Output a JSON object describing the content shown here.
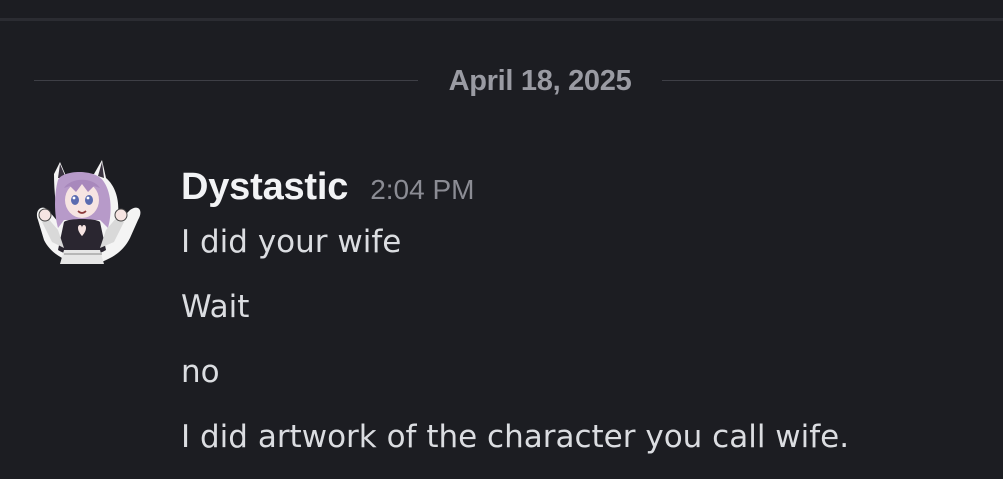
{
  "date_divider": {
    "label": "April 18, 2025"
  },
  "message": {
    "username": "Dystastic",
    "timestamp": "2:04 PM",
    "avatar": {
      "icon": "anime-girl-avatar",
      "hair_color": "#b79ac9",
      "accent_color": "#e8e8e8"
    },
    "lines": [
      "I did your wife",
      "Wait",
      "no",
      "I did artwork of the character you call wife."
    ]
  },
  "colors": {
    "background": "#1c1d22",
    "username": "#f2f3f5",
    "text": "#dbdde1",
    "muted": "#8b8c94"
  }
}
